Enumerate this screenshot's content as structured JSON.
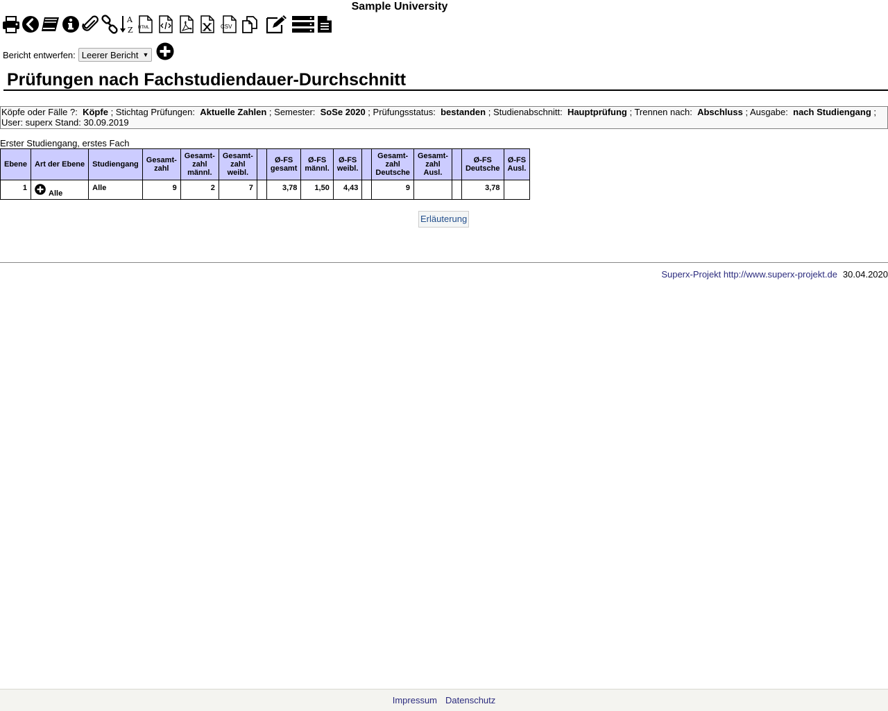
{
  "university": "Sample University",
  "toolbar": {
    "icons": [
      "printer-icon",
      "back-icon",
      "books-icon",
      "info-icon",
      "paperclip-icon",
      "link-icon",
      "sort-az-icon",
      "html-file-icon",
      "code-file-icon",
      "pdf-file-icon",
      "excel-file-icon",
      "csv-file-icon",
      "copy-icon",
      "edit-icon",
      "list-icon",
      "document-icon"
    ],
    "html_label": "HTML",
    "csv_label": "CSV",
    "sort_label": "A Z"
  },
  "draft": {
    "label": "Bericht entwerfen:",
    "selected": "Leerer Bericht"
  },
  "page_title": "Prüfungen nach Fachstudiendauer-Durchschnitt",
  "params": {
    "l1": "Köpfe oder Fälle ?:",
    "v1": "Köpfe",
    "l2": "; Stichtag Prüfungen:",
    "v2": "Aktuelle Zahlen",
    "l3": "; Semester:",
    "v3": "SoSe 2020",
    "l4": "; Prüfungsstatus:",
    "v4": "bestanden",
    "l5": "; Studienabschnitt:",
    "v5": "Hauptprüfung",
    "l6": "; Trennen nach:",
    "v6": "Abschluss",
    "l7": "; Ausgabe:",
    "v7": "nach Studiengang",
    "tail": "; User: superx  Stand: 30.09.2019"
  },
  "table": {
    "caption": "Erster Studiengang, erstes Fach",
    "headers": {
      "ebene": "Ebene",
      "art": "Art der Ebene",
      "studiengang": "Studiengang",
      "gz1": "Gesamt-",
      "gz2": "zahl",
      "gzm1": "Gesamt-",
      "gzm2": "zahl",
      "gzm3": "männl.",
      "gzw1": "Gesamt-",
      "gzw2": "zahl",
      "gzw3": "weibl.",
      "fsg1": "Ø-FS",
      "fsg2": "gesamt",
      "fsm1": "Ø-FS",
      "fsm2": "männl.",
      "fsw1": "Ø-FS",
      "fsw2": "weibl.",
      "gzd1": "Gesamt-",
      "gzd2": "zahl",
      "gzd3": "Deutsche",
      "gza1": "Gesamt-",
      "gza2": "zahl",
      "gza3": "Ausl.",
      "fsd1": "Ø-FS",
      "fsd2": "Deutsche",
      "fsa1": "Ø-FS",
      "fsa2": "Ausl."
    },
    "row": {
      "ebene": "1",
      "art": "Alle",
      "studiengang": "Alle",
      "gesamtzahl": "9",
      "gesamtzahl_maennl": "2",
      "gesamtzahl_weibl": "7",
      "fs_gesamt": "3,78",
      "fs_maennl": "1,50",
      "fs_weibl": "4,43",
      "gesamtzahl_deutsche": "9",
      "gesamtzahl_ausl": "",
      "fs_deutsche": "3,78",
      "fs_ausl": ""
    }
  },
  "explain_label": "Erläuterung",
  "footer": {
    "project_link": "Superx-Projekt http://www.superx-projekt.de",
    "date": "30.04.2020"
  },
  "bottom": {
    "impressum": "Impressum",
    "datenschutz": "Datenschutz"
  }
}
